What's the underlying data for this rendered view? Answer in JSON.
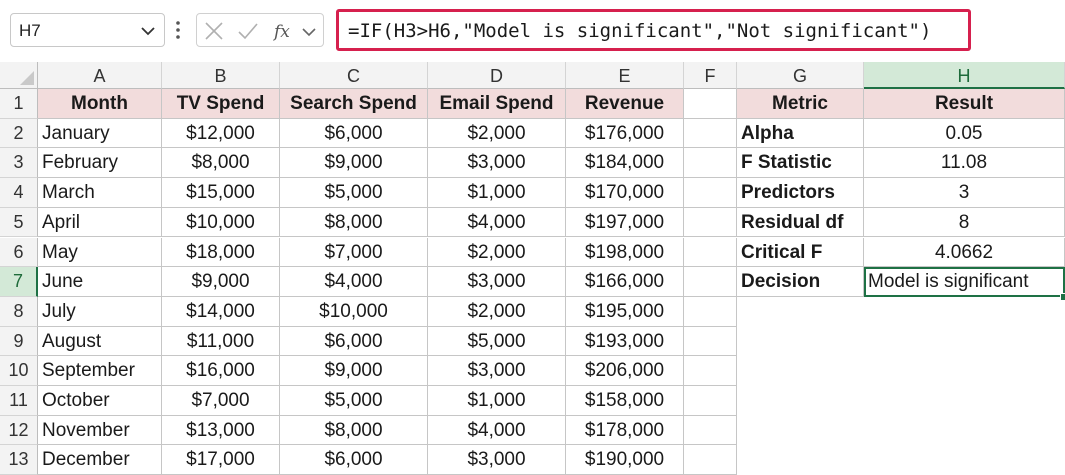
{
  "name_box": {
    "value": "H7"
  },
  "formula_bar": {
    "formula": "=IF(H3>H6,\"Model is significant\",\"Not significant\")"
  },
  "icons": {
    "cancel": "x-icon",
    "enter": "check-icon",
    "function": "fx-icon",
    "expand": "chevron-down-icon"
  },
  "columns": [
    "A",
    "B",
    "C",
    "D",
    "E",
    "F",
    "G",
    "H"
  ],
  "selected_column": "H",
  "rows": [
    "1",
    "2",
    "3",
    "4",
    "5",
    "6",
    "7",
    "8",
    "9",
    "10",
    "11",
    "12",
    "13"
  ],
  "selected_row": "7",
  "table": {
    "headers": [
      "Month",
      "TV Spend",
      "Search Spend",
      "Email Spend",
      "Revenue"
    ],
    "rows": [
      [
        "January",
        "$12,000",
        "$6,000",
        "$2,000",
        "$176,000"
      ],
      [
        "February",
        "$8,000",
        "$9,000",
        "$3,000",
        "$184,000"
      ],
      [
        "March",
        "$15,000",
        "$5,000",
        "$1,000",
        "$170,000"
      ],
      [
        "April",
        "$10,000",
        "$8,000",
        "$4,000",
        "$197,000"
      ],
      [
        "May",
        "$18,000",
        "$7,000",
        "$2,000",
        "$198,000"
      ],
      [
        "June",
        "$9,000",
        "$4,000",
        "$3,000",
        "$166,000"
      ],
      [
        "July",
        "$14,000",
        "$10,000",
        "$2,000",
        "$195,000"
      ],
      [
        "August",
        "$11,000",
        "$6,000",
        "$5,000",
        "$193,000"
      ],
      [
        "September",
        "$16,000",
        "$9,000",
        "$3,000",
        "$206,000"
      ],
      [
        "October",
        "$7,000",
        "$5,000",
        "$1,000",
        "$158,000"
      ],
      [
        "November",
        "$13,000",
        "$8,000",
        "$4,000",
        "$178,000"
      ],
      [
        "December",
        "$17,000",
        "$6,000",
        "$3,000",
        "$190,000"
      ]
    ]
  },
  "results": {
    "headers": [
      "Metric",
      "Result"
    ],
    "rows": [
      [
        "Alpha",
        "0.05"
      ],
      [
        "F Statistic",
        "11.08"
      ],
      [
        "Predictors",
        "3"
      ],
      [
        "Residual df",
        "8"
      ],
      [
        "Critical F",
        "4.0662"
      ],
      [
        "Decision",
        "Model is significant"
      ]
    ]
  },
  "colors": {
    "header_fill": "#f2dcdc",
    "selection": "#1e7145",
    "highlight_border": "#d6204e"
  }
}
